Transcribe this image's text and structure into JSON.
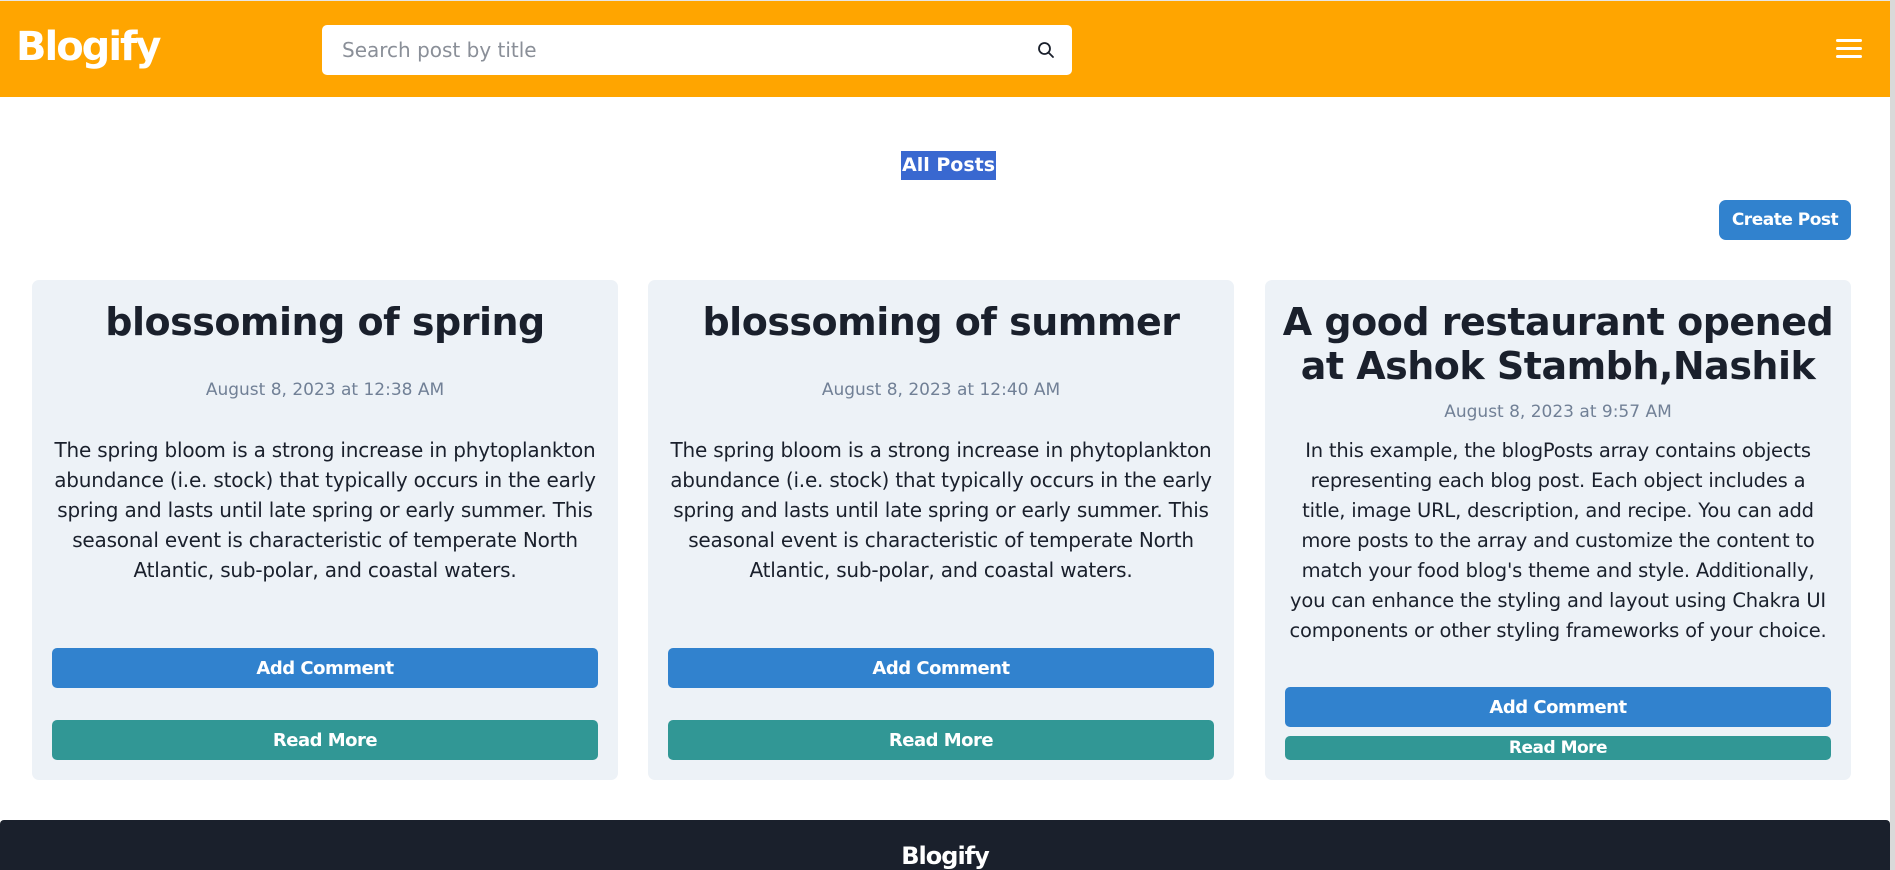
{
  "navbar": {
    "brand": "Blogify",
    "search_placeholder": "Search post by title",
    "search_icon": "search-icon",
    "menu_icon": "hamburger-menu-icon",
    "color": "#ffa500"
  },
  "main": {
    "heading": "All Posts",
    "create_button": "Create Post"
  },
  "posts": [
    {
      "title": "blossoming of spring",
      "date": "August 8, 2023 at 12:38 AM",
      "description": "The spring bloom is a strong increase in phytoplankton abundance (i.e. stock) that typically occurs in the early spring and lasts until late spring or early summer. This seasonal event is characteristic of temperate North Atlantic, sub-polar, and coastal waters.",
      "comment_button": "Add Comment",
      "read_button": "Read More"
    },
    {
      "title": "blossoming of summer",
      "date": "August 8, 2023 at 12:40 AM",
      "description": "The spring bloom is a strong increase in phytoplankton abundance (i.e. stock) that typically occurs in the early spring and lasts until late spring or early summer. This seasonal event is characteristic of temperate North Atlantic, sub-polar, and coastal waters.",
      "comment_button": "Add Comment",
      "read_button": "Read More"
    },
    {
      "title": "A good restaurant opened at Ashok Stambh,Nashik",
      "date": "August 8, 2023 at 9:57 AM",
      "description": "In this example, the blogPosts array contains objects representing each blog post. Each object includes a title, image URL, description, and recipe. You can add more posts to the array and customize the content to match your food blog's theme and style. Additionally, you can enhance the styling and layout using Chakra UI components or other styling frameworks of your choice.",
      "comment_button": "Add Comment",
      "read_button": "Read More"
    }
  ],
  "footer": {
    "brand": "Blogify"
  },
  "colors": {
    "accent_blue": "#3182ce",
    "teal": "#319795",
    "card_bg": "#edf2f7",
    "footer_bg": "#1a202c"
  }
}
